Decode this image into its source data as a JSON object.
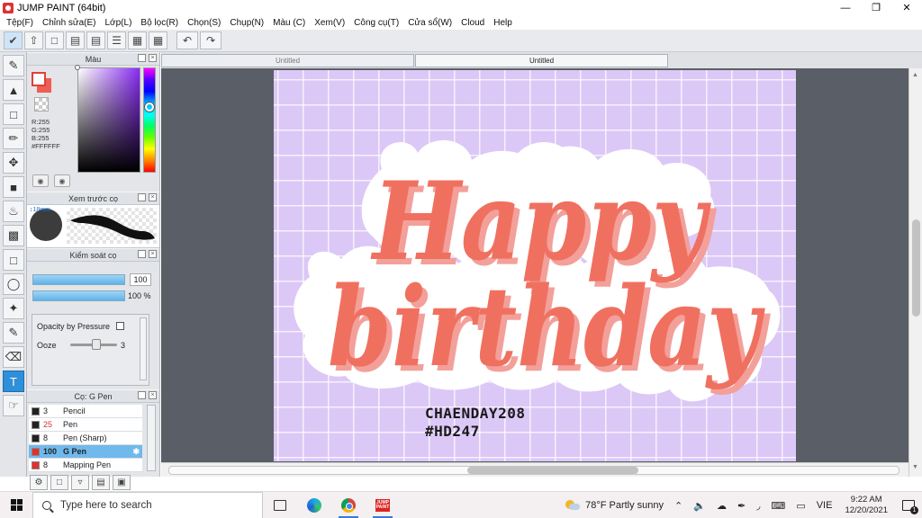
{
  "window": {
    "title": "JUMP PAINT (64bit)",
    "minimize_icon": "minimize-icon",
    "restore_icon": "restore-icon",
    "close_icon": "close-icon"
  },
  "menu": [
    "Tệp(F)",
    "Chỉnh sửa(E)",
    "Lớp(L)",
    "Bộ lọc(R)",
    "Chọn(S)",
    "Chụp(N)",
    "Màu (C)",
    "Xem(V)",
    "Công cụ(T)",
    "Cửa sổ(W)",
    "Cloud",
    "Help"
  ],
  "tabs": [
    {
      "label": "Untitled",
      "active": false
    },
    {
      "label": "Untitled",
      "active": true
    }
  ],
  "color_panel": {
    "title": "Màu",
    "r": "R:255",
    "g": "G:255",
    "b": "B:255",
    "hex": "#FFFFFF",
    "fg_color": "#ffffff",
    "bg_color": "#ee5e52"
  },
  "brush_preview": {
    "title": "Xem trước cọ",
    "size_label": "↕18mm"
  },
  "brush_control": {
    "title": "Kiểm soát cọ",
    "size_value": "100",
    "opacity_value": "100 %",
    "opacity_pressure_label": "Opacity by Pressure",
    "ooze_label": "Ooze",
    "ooze_value": "3"
  },
  "brush_list": {
    "title": "Cọ: G Pen",
    "items": [
      {
        "size": "3",
        "name": "Pencil",
        "color": "#222222",
        "size_color": "#222222",
        "selected": false
      },
      {
        "size": "25",
        "name": "Pen",
        "color": "#222222",
        "size_color": "#d33333",
        "selected": false
      },
      {
        "size": "8",
        "name": "Pen (Sharp)",
        "color": "#222222",
        "size_color": "#222222",
        "selected": false
      },
      {
        "size": "100",
        "name": "G Pen",
        "color": "#e03030",
        "size_color": "#d33333",
        "selected": true
      },
      {
        "size": "8",
        "name": "Mapping Pen",
        "color": "#e03030",
        "size_color": "#222222",
        "selected": false
      }
    ]
  },
  "canvas": {
    "line1": "Happy",
    "line2": "birthday",
    "credit_line1": "CHAENDAY208",
    "credit_line2": "#HD247",
    "background_color": "#dcc8f6",
    "lettering_color": "#f07060",
    "shadow_color": "#f3a09a"
  },
  "taskbar": {
    "search_placeholder": "Type here to search",
    "weather": "78°F  Partly sunny",
    "language": "VIE",
    "time": "9:22 AM",
    "date": "12/20/2021",
    "notification_count": "1"
  }
}
